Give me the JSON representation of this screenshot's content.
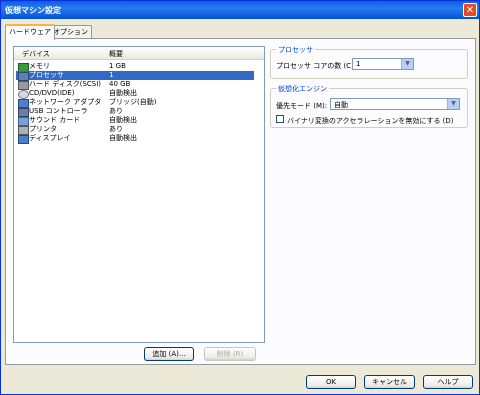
{
  "window": {
    "title": "仮想マシン設定",
    "close_glyph": "✕"
  },
  "tabs": [
    {
      "label": "ハードウェア"
    },
    {
      "label": "オプション"
    }
  ],
  "device_list": {
    "col_device": "デバイス",
    "col_summary": "概要",
    "rows": [
      {
        "name": "メモリ",
        "summary": "1 GB",
        "icon": "memory-icon"
      },
      {
        "name": "プロセッサ",
        "summary": "1",
        "icon": "processor-icon",
        "selected": true
      },
      {
        "name": "ハード ディスク(SCSI)",
        "summary": "40 GB",
        "icon": "hard-disk-icon"
      },
      {
        "name": "CD/DVD(IDE)",
        "summary": "自動検出",
        "icon": "cd-dvd-icon"
      },
      {
        "name": "ネットワーク アダプタ",
        "summary": "ブリッジ(自動)",
        "icon": "network-icon"
      },
      {
        "name": "USB コントローラ",
        "summary": "あり",
        "icon": "usb-icon"
      },
      {
        "name": "サウンド カード",
        "summary": "自動検出",
        "icon": "sound-icon"
      },
      {
        "name": "プリンタ",
        "summary": "あり",
        "icon": "printer-icon"
      },
      {
        "name": "ディスプレイ",
        "summary": "自動検出",
        "icon": "display-icon"
      }
    ]
  },
  "list_buttons": {
    "add": "追加 (A)...",
    "remove": "削除 (R)"
  },
  "processor": {
    "legend": "プロセッサ",
    "cores_label": "プロセッサ コアの数 (C):",
    "cores_value": "1"
  },
  "virtualization": {
    "legend": "仮想化エンジン",
    "mode_label": "優先モード (M):",
    "mode_value": "自動",
    "checkbox_label": "バイナリ変換のアクセラレーションを無効にする (D)",
    "checkbox_checked": false
  },
  "footer": {
    "ok": "OK",
    "cancel": "キャンセル",
    "help": "ヘルプ"
  }
}
